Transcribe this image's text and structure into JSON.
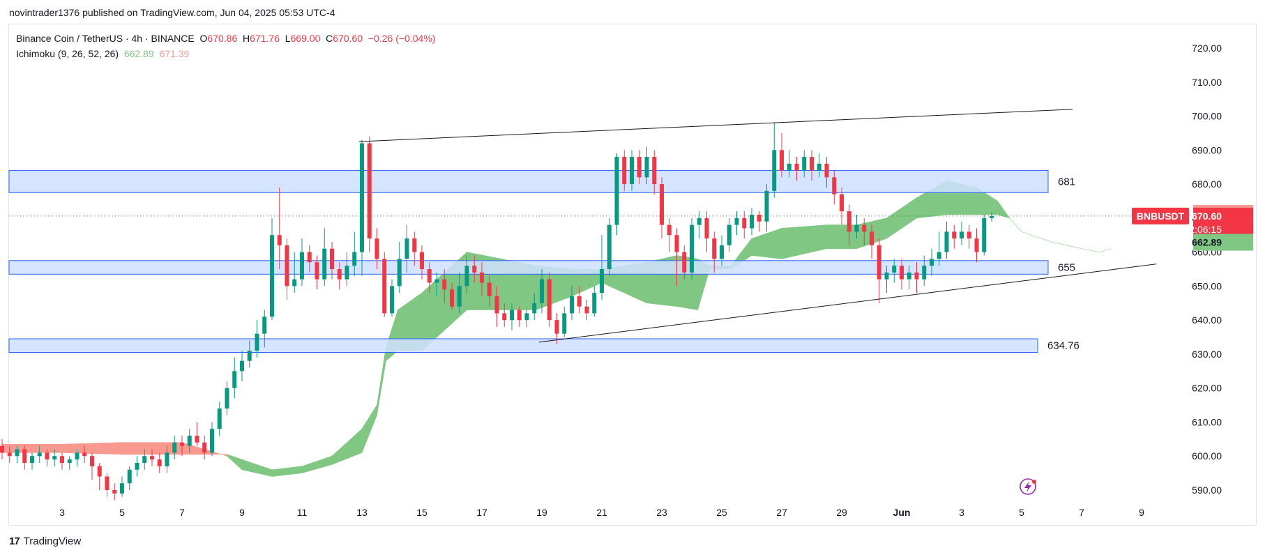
{
  "header": {
    "publish_text": "novintrader1376 published on TradingView.com, Jun 04, 2025 05:53 UTC-4"
  },
  "legend": {
    "symbol": "Binance Coin / TetherUS · 4h · BINANCE",
    "o_label": "O",
    "o_value": "670.86",
    "h_label": "H",
    "h_value": "671.76",
    "l_label": "L",
    "l_value": "669.00",
    "c_label": "C",
    "c_value": "670.60",
    "change": "−0.26 (−0.04%)",
    "indicator": "Ichimoku (9, 26, 52, 26)",
    "ind_value_a": "662.89",
    "ind_value_b": "671.39"
  },
  "footer": {
    "brand": "TradingView",
    "logo": "17"
  },
  "colors": {
    "up": "#089981",
    "down": "#f23645",
    "zone_fill": "#cfe0ff",
    "zone_stroke": "#2962ff",
    "cloud_bull": "#81c784",
    "cloud_bear": "#f7998f",
    "price_label": "#f23645",
    "lead_a_label": "#81c784",
    "lead_b_label": "#f7998f"
  },
  "chart_data": {
    "type": "candlestick",
    "symbol": "BNBUSDT",
    "timeframe": "4h",
    "exchange": "BINANCE",
    "ylim": [
      586,
      726
    ],
    "y_ticks": [
      "720.00",
      "710.00",
      "700.00",
      "690.00",
      "680.00",
      "670.00",
      "660.00",
      "650.00",
      "640.00",
      "630.00",
      "620.00",
      "610.00",
      "600.00",
      "590.00"
    ],
    "x_ticks": [
      "3",
      "5",
      "7",
      "9",
      "11",
      "13",
      "15",
      "17",
      "19",
      "21",
      "23",
      "25",
      "27",
      "29",
      "Jun",
      "3",
      "5",
      "7",
      "9"
    ],
    "horizontal_zones": [
      {
        "label": "681",
        "low": 677.5,
        "high": 684.0
      },
      {
        "label": "655",
        "low": 653.5,
        "high": 657.5
      },
      {
        "label": "634.76",
        "low": 630.5,
        "high": 634.5
      }
    ],
    "trendlines": [
      {
        "name": "upper-trendline",
        "from": [
          "May 12",
          692.5
        ],
        "to": [
          "Jun 8",
          702.0
        ]
      },
      {
        "name": "lower-trendline",
        "from": [
          "May 18",
          633.5
        ],
        "to": [
          "Jun 9",
          656.5
        ]
      }
    ],
    "last_price": {
      "ticker": "BNBUSDT",
      "value": "670.60",
      "countdown": "02:06:15"
    },
    "ichimoku_labels": {
      "leading_span_b": "671.39",
      "leading_span_a": "662.89"
    },
    "cloud": {
      "span_a_points": [
        [
          1,
          601
        ],
        [
          3,
          601
        ],
        [
          5,
          600.5
        ],
        [
          7,
          600.5
        ],
        [
          8.5,
          600.5
        ],
        [
          9,
          599
        ],
        [
          10,
          596
        ],
        [
          11,
          597
        ],
        [
          12,
          600
        ],
        [
          13,
          608
        ],
        [
          13.5,
          615
        ],
        [
          13.8,
          632
        ],
        [
          14.2,
          643
        ],
        [
          15,
          648
        ],
        [
          16.5,
          660
        ],
        [
          18.8,
          656
        ],
        [
          20,
          655
        ],
        [
          21,
          655
        ],
        [
          22.5,
          657
        ],
        [
          23.5,
          659
        ],
        [
          24.2,
          658
        ],
        [
          24.6,
          656
        ],
        [
          25.3,
          656
        ],
        [
          26,
          664
        ],
        [
          27,
          667
        ],
        [
          28.5,
          668
        ],
        [
          29.5,
          668
        ],
        [
          30.5,
          670
        ],
        [
          31.5,
          676
        ],
        [
          32.5,
          681
        ],
        [
          33.5,
          679
        ],
        [
          34.2,
          675
        ],
        [
          34.6,
          670
        ],
        [
          35,
          666
        ],
        [
          36,
          663
        ],
        [
          37,
          661
        ],
        [
          37.6,
          660
        ],
        [
          38,
          661
        ]
      ],
      "span_b_points": [
        [
          1,
          603.5
        ],
        [
          3,
          603.5
        ],
        [
          5,
          604
        ],
        [
          7,
          604
        ],
        [
          8.5,
          600
        ],
        [
          9,
          596
        ],
        [
          10,
          594
        ],
        [
          11,
          595
        ],
        [
          12,
          597.5
        ],
        [
          13,
          601
        ],
        [
          13.5,
          612
        ],
        [
          13.8,
          628
        ],
        [
          14.2,
          631
        ],
        [
          15,
          631
        ],
        [
          16.5,
          643
        ],
        [
          18.8,
          643
        ],
        [
          20,
          647
        ],
        [
          21,
          651
        ],
        [
          22.5,
          645
        ],
        [
          23.5,
          644
        ],
        [
          24.2,
          643
        ],
        [
          24.6,
          655
        ],
        [
          25.3,
          655
        ],
        [
          26,
          659
        ],
        [
          27,
          658
        ],
        [
          28.5,
          661
        ],
        [
          29.5,
          661
        ],
        [
          30.5,
          664
        ],
        [
          31.5,
          670
        ],
        [
          32.5,
          671
        ],
        [
          33.5,
          671
        ],
        [
          34.2,
          671
        ],
        [
          34.6,
          670
        ],
        [
          35,
          666
        ],
        [
          36,
          663
        ],
        [
          37,
          661
        ],
        [
          37.6,
          660
        ],
        [
          38,
          661
        ]
      ]
    },
    "candles_approx": [
      [
        1.0,
        603,
        601,
        605,
        599
      ],
      [
        1.25,
        601,
        600,
        603,
        598
      ],
      [
        1.5,
        600,
        602,
        603,
        598
      ],
      [
        1.75,
        602,
        598,
        603,
        596
      ],
      [
        2.0,
        598,
        600,
        601,
        596
      ],
      [
        2.25,
        600,
        601,
        603,
        598
      ],
      [
        2.5,
        601,
        599,
        602,
        597
      ],
      [
        2.75,
        599,
        600,
        602,
        597
      ],
      [
        3.0,
        600,
        598,
        601,
        596
      ],
      [
        3.25,
        598,
        599,
        600,
        596
      ],
      [
        3.5,
        599,
        601,
        602,
        597
      ],
      [
        3.75,
        601,
        600,
        603,
        598
      ],
      [
        4.0,
        600,
        597,
        601,
        593
      ],
      [
        4.25,
        597,
        594,
        598,
        590
      ],
      [
        4.5,
        594,
        590,
        595,
        588
      ],
      [
        4.75,
        590,
        589,
        592,
        587
      ],
      [
        5.0,
        589,
        592,
        594,
        588
      ],
      [
        5.25,
        592,
        596,
        597,
        590
      ],
      [
        5.5,
        596,
        598,
        600,
        594
      ],
      [
        5.75,
        598,
        600,
        602,
        596
      ],
      [
        6.0,
        600,
        599,
        602,
        597
      ],
      [
        6.25,
        599,
        597,
        601,
        595
      ],
      [
        6.5,
        597,
        601,
        603,
        595
      ],
      [
        6.75,
        601,
        604,
        606,
        599
      ],
      [
        7.0,
        604,
        603,
        606,
        600
      ],
      [
        7.25,
        603,
        606,
        608,
        601
      ],
      [
        7.5,
        606,
        604,
        610,
        603
      ],
      [
        7.75,
        604,
        601,
        606,
        599
      ],
      [
        8.0,
        601,
        608,
        610,
        600
      ],
      [
        8.25,
        608,
        614,
        616,
        606
      ],
      [
        8.5,
        614,
        620,
        622,
        612
      ],
      [
        8.75,
        620,
        625,
        629,
        617
      ],
      [
        9.0,
        625,
        628,
        631,
        622
      ],
      [
        9.25,
        628,
        631,
        634,
        626
      ],
      [
        9.5,
        631,
        636,
        640,
        629
      ],
      [
        9.75,
        636,
        641,
        643,
        632
      ],
      [
        10.0,
        641,
        665,
        670,
        640
      ],
      [
        10.25,
        665,
        662,
        679,
        655
      ],
      [
        10.5,
        662,
        650,
        664,
        646
      ],
      [
        10.75,
        650,
        652,
        660,
        648
      ],
      [
        11.0,
        652,
        660,
        664,
        650
      ],
      [
        11.25,
        660,
        657,
        662,
        654
      ],
      [
        11.5,
        657,
        652,
        659,
        649
      ],
      [
        11.75,
        652,
        661,
        667,
        650
      ],
      [
        12.0,
        661,
        655,
        663,
        652
      ],
      [
        12.25,
        655,
        652,
        657,
        649
      ],
      [
        12.5,
        652,
        656,
        660,
        650
      ],
      [
        12.75,
        656,
        660,
        666,
        653
      ],
      [
        13.0,
        660,
        692,
        693,
        653
      ],
      [
        13.25,
        692,
        664,
        694,
        660
      ],
      [
        13.5,
        664,
        658,
        667,
        655
      ],
      [
        13.75,
        658,
        642,
        660,
        641
      ],
      [
        14.0,
        642,
        650,
        652,
        641
      ],
      [
        14.25,
        650,
        658,
        663,
        648
      ],
      [
        14.5,
        658,
        664,
        668,
        654
      ],
      [
        14.75,
        664,
        660,
        666,
        656
      ],
      [
        15.0,
        660,
        655,
        662,
        652
      ],
      [
        15.25,
        655,
        651,
        657,
        648
      ],
      [
        15.5,
        651,
        652,
        654,
        647
      ],
      [
        15.75,
        652,
        649,
        655,
        645
      ],
      [
        16.0,
        649,
        644,
        651,
        643
      ],
      [
        16.25,
        644,
        650,
        654,
        642
      ],
      [
        16.5,
        650,
        656,
        659,
        648
      ],
      [
        16.75,
        656,
        654,
        659,
        651
      ],
      [
        17.0,
        654,
        651,
        657,
        647
      ],
      [
        17.25,
        651,
        647,
        653,
        644
      ],
      [
        17.5,
        647,
        642,
        650,
        638
      ],
      [
        17.75,
        642,
        640,
        645,
        638
      ],
      [
        18.0,
        640,
        643,
        645,
        637
      ],
      [
        18.25,
        643,
        640,
        644,
        638
      ],
      [
        18.5,
        640,
        642,
        643,
        638
      ],
      [
        18.75,
        642,
        645,
        648,
        640
      ],
      [
        19.0,
        645,
        652,
        655,
        642
      ],
      [
        19.25,
        652,
        640,
        654,
        638
      ],
      [
        19.5,
        640,
        636,
        642,
        633
      ],
      [
        19.75,
        636,
        642,
        644,
        635
      ],
      [
        20.0,
        642,
        647,
        650,
        640
      ],
      [
        20.25,
        647,
        644,
        650,
        642
      ],
      [
        20.5,
        644,
        642,
        646,
        640
      ],
      [
        20.75,
        642,
        648,
        650,
        641
      ],
      [
        21.0,
        648,
        655,
        665,
        646
      ],
      [
        21.25,
        655,
        668,
        670,
        653
      ],
      [
        21.5,
        668,
        688,
        689,
        665
      ],
      [
        21.75,
        688,
        680,
        690,
        678
      ],
      [
        22.0,
        680,
        688,
        690,
        678
      ],
      [
        22.25,
        688,
        682,
        690,
        680
      ],
      [
        22.5,
        682,
        688,
        691,
        680
      ],
      [
        22.75,
        688,
        680,
        690,
        677
      ],
      [
        23.0,
        680,
        668,
        682,
        664
      ],
      [
        23.25,
        668,
        665,
        670,
        660
      ],
      [
        23.5,
        665,
        660,
        667,
        650
      ],
      [
        23.75,
        660,
        654,
        662,
        652
      ],
      [
        24.0,
        654,
        668,
        670,
        652
      ],
      [
        24.25,
        668,
        670,
        672,
        664
      ],
      [
        24.5,
        670,
        664,
        672,
        660
      ],
      [
        24.75,
        664,
        658,
        666,
        654
      ],
      [
        25.0,
        658,
        662,
        665,
        656
      ],
      [
        25.25,
        662,
        668,
        670,
        660
      ],
      [
        25.5,
        668,
        670,
        672,
        665
      ],
      [
        25.75,
        670,
        667,
        672,
        664
      ],
      [
        26.0,
        667,
        671,
        673,
        665
      ],
      [
        26.25,
        671,
        669,
        672,
        666
      ],
      [
        26.5,
        669,
        678,
        680,
        666
      ],
      [
        26.75,
        678,
        690,
        698,
        676
      ],
      [
        27.0,
        690,
        684,
        695,
        682
      ],
      [
        27.25,
        684,
        686,
        690,
        682
      ],
      [
        27.5,
        686,
        684,
        688,
        681
      ],
      [
        27.75,
        684,
        688,
        690,
        682
      ],
      [
        28.0,
        688,
        684,
        690,
        681
      ],
      [
        28.25,
        684,
        686,
        689,
        682
      ],
      [
        28.5,
        686,
        682,
        688,
        679
      ],
      [
        28.75,
        682,
        677,
        684,
        674
      ],
      [
        29.0,
        677,
        672,
        679,
        668
      ],
      [
        29.25,
        672,
        666,
        674,
        662
      ],
      [
        29.5,
        666,
        668,
        671,
        664
      ],
      [
        29.75,
        668,
        666,
        670,
        662
      ],
      [
        30.0,
        666,
        662,
        668,
        658
      ],
      [
        30.25,
        662,
        652,
        664,
        645
      ],
      [
        30.5,
        652,
        654,
        656,
        648
      ],
      [
        30.75,
        654,
        656,
        658,
        651
      ],
      [
        31.0,
        656,
        652,
        658,
        649
      ],
      [
        31.25,
        652,
        654,
        656,
        649
      ],
      [
        31.5,
        654,
        652,
        657,
        648
      ],
      [
        31.75,
        652,
        656,
        659,
        650
      ],
      [
        32.0,
        656,
        658,
        661,
        653
      ],
      [
        32.25,
        658,
        660,
        666,
        656
      ],
      [
        32.5,
        660,
        666,
        669,
        658
      ],
      [
        32.75,
        666,
        664,
        668,
        661
      ],
      [
        33.0,
        664,
        666,
        669,
        662
      ],
      [
        33.25,
        666,
        664,
        668,
        661
      ],
      [
        33.5,
        664,
        660,
        667,
        657
      ],
      [
        33.75,
        660,
        670,
        671,
        659
      ],
      [
        34.0,
        670,
        670.6,
        671.8,
        669
      ]
    ]
  }
}
